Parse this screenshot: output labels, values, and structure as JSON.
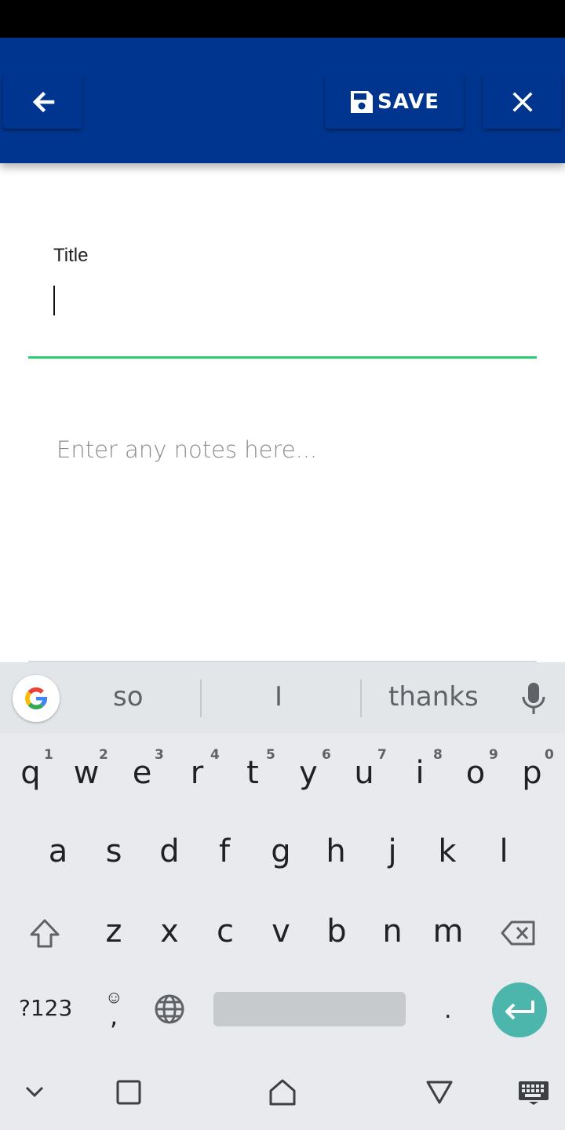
{
  "toolbar": {
    "save_label": "SAVE"
  },
  "form": {
    "title_label": "Title",
    "title_value": "",
    "notes_placeholder": "Enter any notes here..."
  },
  "keyboard": {
    "suggestions": [
      "so",
      "I",
      "thanks"
    ],
    "row1": [
      {
        "key": "q",
        "hint": "1"
      },
      {
        "key": "w",
        "hint": "2"
      },
      {
        "key": "e",
        "hint": "3"
      },
      {
        "key": "r",
        "hint": "4"
      },
      {
        "key": "t",
        "hint": "5"
      },
      {
        "key": "y",
        "hint": "6"
      },
      {
        "key": "u",
        "hint": "7"
      },
      {
        "key": "i",
        "hint": "8"
      },
      {
        "key": "o",
        "hint": "9"
      },
      {
        "key": "p",
        "hint": "0"
      }
    ],
    "row2": [
      "a",
      "s",
      "d",
      "f",
      "g",
      "h",
      "j",
      "k",
      "l"
    ],
    "row3": [
      "z",
      "x",
      "c",
      "v",
      "b",
      "n",
      "m"
    ],
    "symbols_label": "?123",
    "comma_label": ",",
    "period_label": ".",
    "emoji_glyph": "☺"
  },
  "icons": {
    "back": "arrow-left-icon",
    "save": "floppy-disk-icon",
    "close": "close-icon",
    "google": "google-logo-icon",
    "mic": "microphone-icon",
    "shift": "shift-icon",
    "backspace": "backspace-icon",
    "globe": "globe-icon",
    "enter": "enter-icon"
  },
  "colors": {
    "app_bar": "#00358f",
    "accent_underline": "#2ecc71",
    "enter_key": "#4db6ac"
  }
}
